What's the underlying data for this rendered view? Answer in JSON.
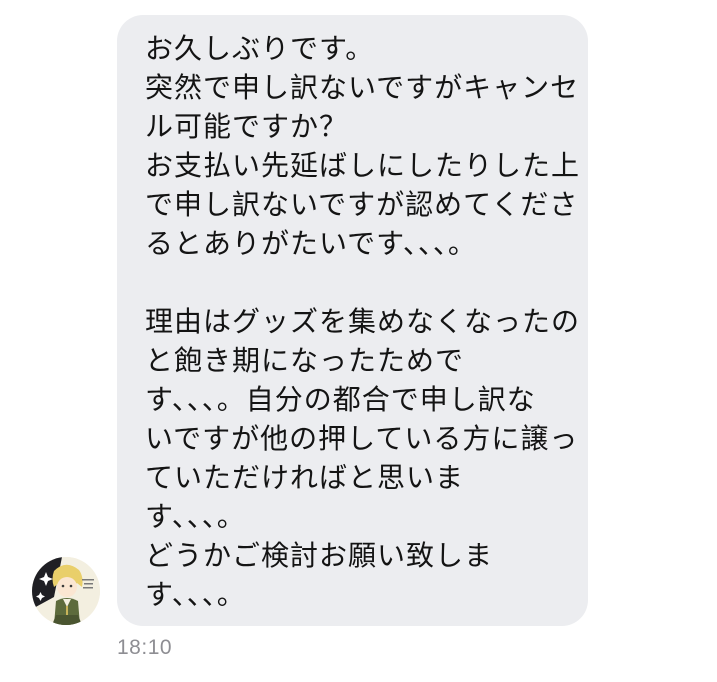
{
  "message": {
    "lines": [
      "お久しぶりです。",
      "突然で申し訳ないですがキャンセ",
      "ル可能ですか？",
      "お支払い先延ばしにしたりした上",
      "で申し訳ないですが認めてくださ",
      "るとありがたいです、、、。",
      "",
      "理由はグッズを集めなくなったの",
      "と飽き期になったためで",
      "す、、、。自分の都合で申し訳な",
      "いですが他の押している方に譲っ",
      "ていただければと思いま",
      "す、、、。",
      "どうかご検討お願い致しま",
      "す、、、。"
    ],
    "timestamp": "18:10"
  },
  "sender": {
    "avatar_icon": "user-avatar-anime-character"
  },
  "colors": {
    "bubble_background": "#ecedf0",
    "text": "#141414",
    "timestamp": "#8e8e93"
  }
}
